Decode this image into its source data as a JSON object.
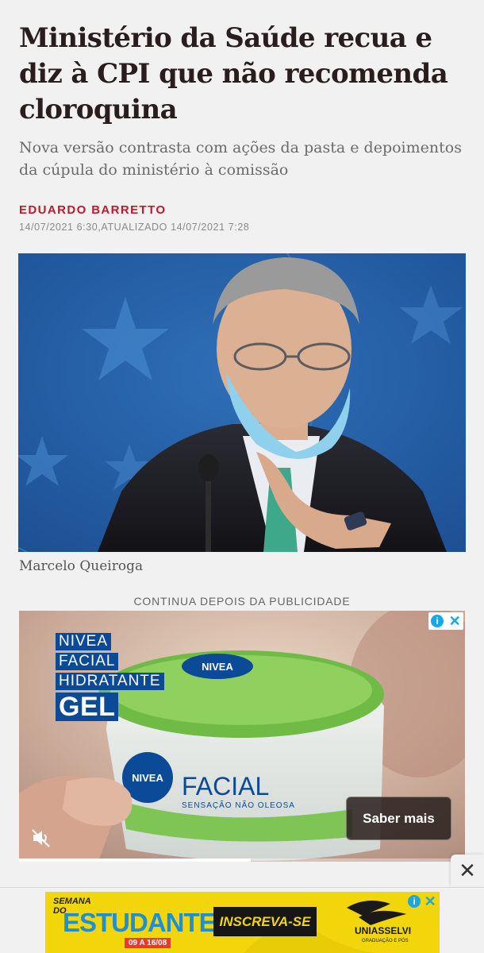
{
  "article": {
    "headline": "Ministério da Saúde recua e diz à CPI que não recomenda cloroquina",
    "subtitle": "Nova versão contrasta com ações da pasta e depoimentos da cúpula do ministério à comissão",
    "author": "EDUARDO BARRETTO",
    "dateline": "14/07/2021 6:30,ATUALIZADO 14/07/2021 7:28",
    "photo_caption": "Marcelo Queiroga"
  },
  "ad_notice": "CONTINUA DEPOIS DA PUBLICIDADE",
  "video_ad": {
    "headline_lines": [
      "NIVEA",
      "FACIAL",
      "HIDRATANTE",
      "GEL"
    ],
    "jar_brand": "NIVEA",
    "jar_product": "FACIAL",
    "jar_tagline": "SENSAÇÃO NÃO OLEOSA",
    "cta_label": "Saber mais",
    "info_glyph": "i",
    "close_glyph": "✕",
    "muted": true,
    "progress_fraction": 0.52,
    "colors": {
      "nivea_blue": "#0b4a97",
      "adchoices_blue": "#1aa7e5"
    }
  },
  "sticky_close_glyph": "✕",
  "bottom_banner": {
    "semana_lines": [
      "SEMANA",
      "DO"
    ],
    "title": "ESTUDANTE",
    "dates": "09 A 16/08",
    "cta_label": "INSCREVA-SE",
    "brand": "UNIASSELVI",
    "brand_sub": "GRADUAÇÃO E PÓS",
    "colors": {
      "background": "#f2d60b",
      "title": "#1d8fd6"
    }
  },
  "colors": {
    "author_red": "#c2182b",
    "headline": "#2a1d1d",
    "page_bg": "#f1f1f1"
  }
}
